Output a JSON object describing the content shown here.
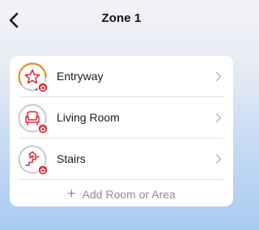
{
  "header": {
    "title": "Zone 1",
    "back_icon": "chevron-left-icon"
  },
  "rooms": [
    {
      "label": "Entryway",
      "icon": "star-icon",
      "badge_icon": "home-badge-icon",
      "ring": "partial-orange"
    },
    {
      "label": "Living Room",
      "icon": "armchair-icon",
      "badge_icon": "home-badge-icon",
      "ring": "full-gray"
    },
    {
      "label": "Stairs",
      "icon": "stairs-icon",
      "badge_icon": "home-badge-icon",
      "ring": "full-gray"
    }
  ],
  "add_room": {
    "label": "Add Room or Area",
    "icon": "plus-icon"
  },
  "colors": {
    "accent_red": "#e02c3c",
    "ring_orange": "#f08a24",
    "ring_gray": "#c8c8cc",
    "chevron_gray": "#b9b9be",
    "muted_text": "#8d8d94"
  }
}
